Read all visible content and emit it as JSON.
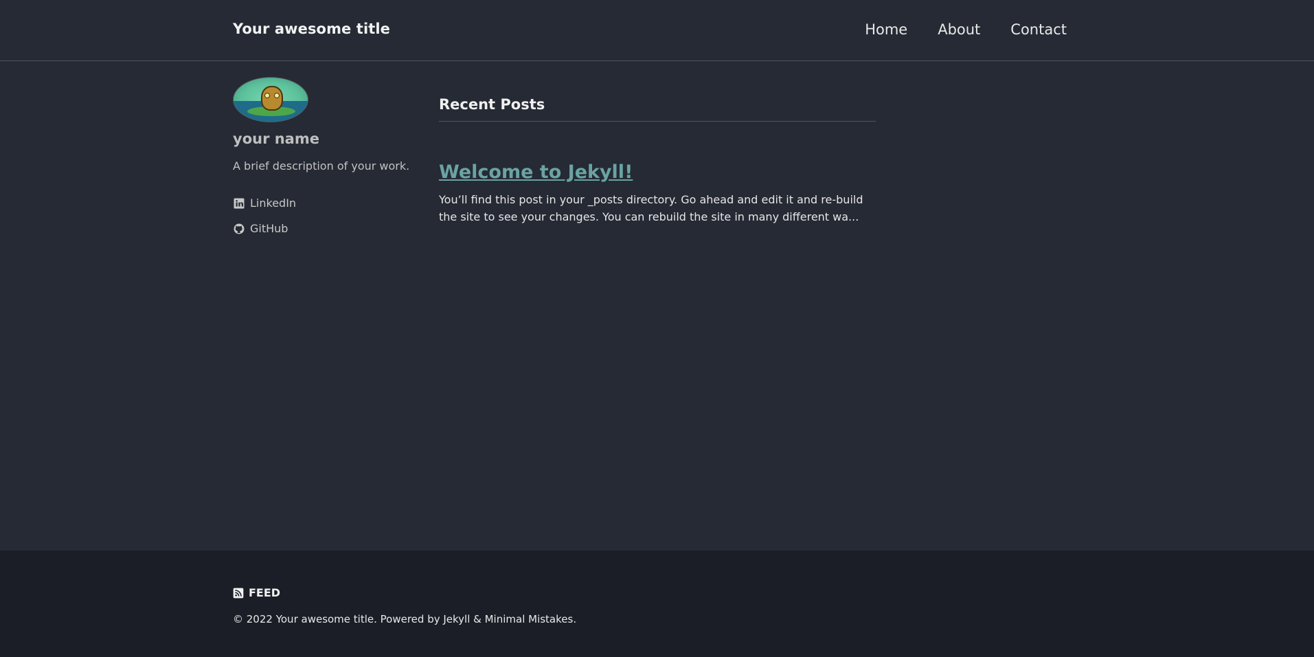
{
  "header": {
    "site_title": "Your awesome title",
    "nav": [
      "Home",
      "About",
      "Contact"
    ]
  },
  "sidebar": {
    "author_name": "your name",
    "bio": "A brief description of your work.",
    "links": [
      {
        "label": "LinkedIn",
        "icon": "linkedin-icon"
      },
      {
        "label": "GitHub",
        "icon": "github-icon"
      }
    ]
  },
  "main": {
    "section_title": "Recent Posts",
    "posts": [
      {
        "title": "Welcome to Jekyll!",
        "excerpt": "You’ll find this post in your _posts directory. Go ahead and edit it and re-build the site to see your changes. You can rebuild the site in many different wa..."
      }
    ]
  },
  "footer": {
    "feed_label": "FEED",
    "copyright": "© 2022 Your awesome title. Powered by Jekyll & Minimal Mistakes."
  },
  "colors": {
    "background": "#252a34",
    "footer_background": "#1b1e26",
    "link_accent": "#6aa3a3"
  }
}
